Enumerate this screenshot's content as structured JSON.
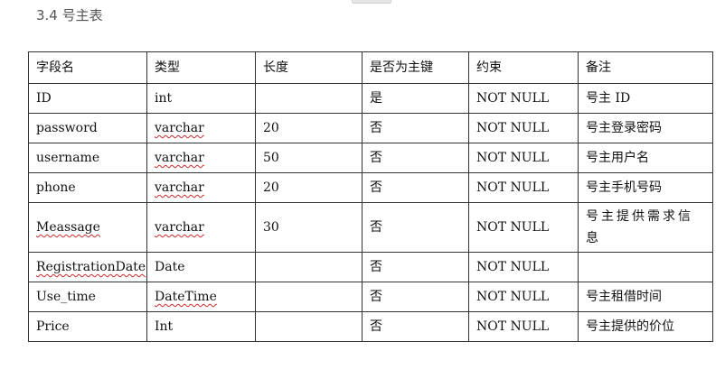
{
  "section_title": "3.4 号主表",
  "table": {
    "headers": [
      "字段名",
      "类型",
      "长度",
      "是否为主键",
      "约束",
      "备注"
    ],
    "rows": [
      [
        "ID",
        "int",
        "",
        "是",
        "NOT NULL",
        "号主 ID"
      ],
      [
        "password",
        "varchar",
        "20",
        "否",
        "NOT NULL",
        "号主登录密码"
      ],
      [
        "username",
        "varchar",
        "50",
        "否",
        "NOT NULL",
        "号主用户名"
      ],
      [
        "phone",
        "varchar",
        "20",
        "否",
        "NOT NULL",
        "号主手机号码"
      ],
      [
        "Meassage",
        "varchar",
        "30",
        "否",
        "NOT NULL",
        "号主提供需求信息"
      ],
      [
        "RegistrationDate",
        "Date",
        "",
        "否",
        "NOT NULL",
        ""
      ],
      [
        "Use_time",
        "DateTime",
        "",
        "否",
        "NOT NULL",
        "号主租借时间"
      ],
      [
        "Price",
        "Int",
        "",
        "否",
        "NOT NULL",
        "号主提供的价位"
      ]
    ]
  },
  "spellcheck_color": "#cc2b2b"
}
